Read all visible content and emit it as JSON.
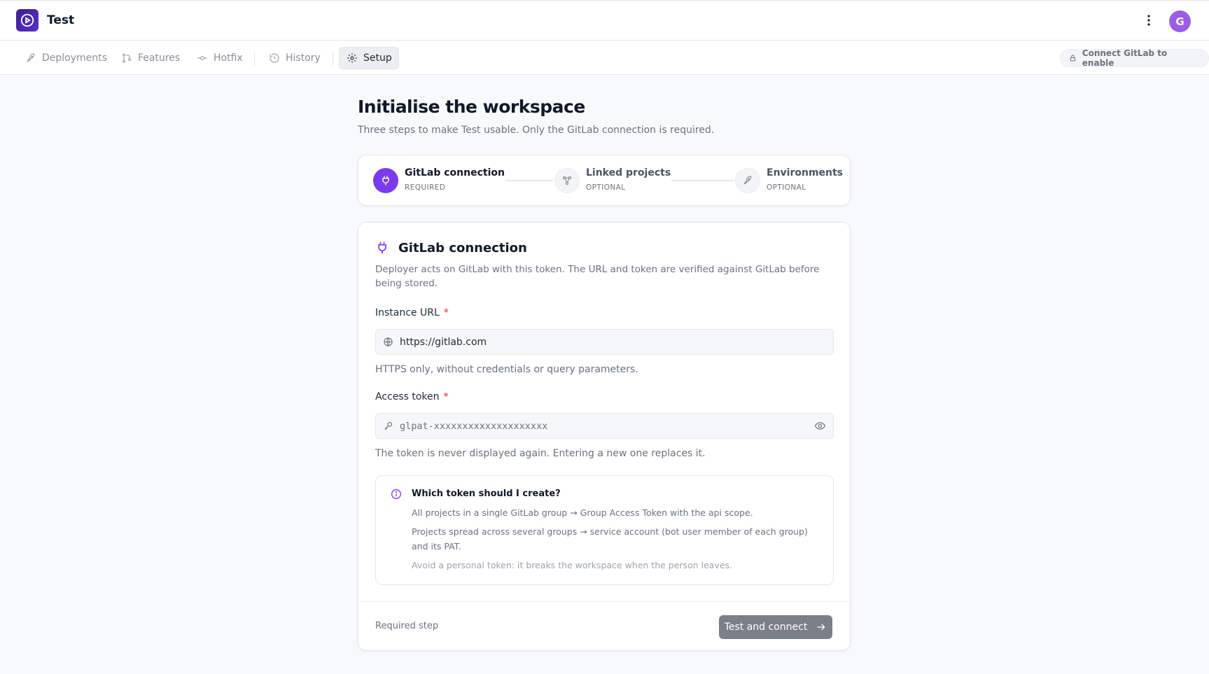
{
  "app": {
    "title": "Test",
    "avatar_initial": "G"
  },
  "nav": {
    "items": [
      {
        "label": "Deployments",
        "icon": "rocket-icon"
      },
      {
        "label": "Features",
        "icon": "git-branch-icon"
      },
      {
        "label": "Hotfix",
        "icon": "git-commit-icon"
      },
      {
        "label": "History",
        "icon": "history-icon"
      },
      {
        "label": "Setup",
        "icon": "gear-icon",
        "active": true
      }
    ],
    "connect_label": "Connect GitLab to enable"
  },
  "page": {
    "title": "Initialise the workspace",
    "subtitle": "Three steps to make Test usable. Only the GitLab connection is required."
  },
  "steps": [
    {
      "title": "GitLab connection",
      "tag": "REQUIRED",
      "icon": "plug-icon",
      "active": true
    },
    {
      "title": "Linked projects",
      "tag": "OPTIONAL",
      "icon": "share-nodes-icon"
    },
    {
      "title": "Environments",
      "tag": "OPTIONAL",
      "icon": "rocket-icon"
    }
  ],
  "card": {
    "title": "GitLab connection",
    "description": "Deployer acts on GitLab with this token. The URL and token are verified against GitLab before being stored.",
    "url_label": "Instance URL",
    "url_value": "https://gitlab.com",
    "url_hint": "HTTPS only, without credentials or query parameters.",
    "token_label": "Access token",
    "token_placeholder": "glpat-xxxxxxxxxxxxxxxxxxxx",
    "token_hint": "The token is never displayed again. Entering a new one replaces it.",
    "required_mark": "*",
    "info": {
      "title": "Which token should I create?",
      "line1": "All projects in a single GitLab group → Group Access Token with the api scope.",
      "line2": "Projects spread across several groups → service account (bot user member of each group) and its PAT.",
      "line3": "Avoid a personal token: it breaks the workspace when the person leaves."
    },
    "footer_label": "Required step",
    "submit_label": "Test and connect"
  },
  "colors": {
    "accent": "#7c3aed",
    "brand_dark": "#3b1f8f",
    "avatar": "#9b5de5",
    "required": "#dc2626"
  }
}
